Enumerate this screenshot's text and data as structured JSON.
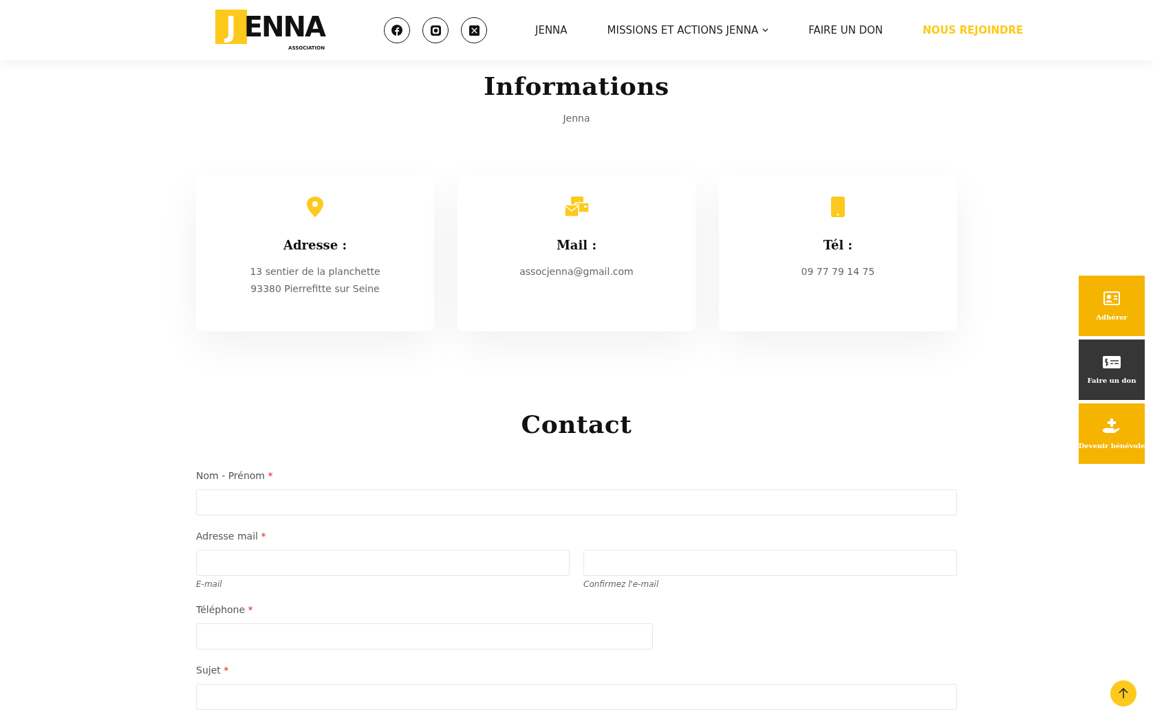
{
  "header": {
    "logo": {
      "letter": "J",
      "word": "ENNA",
      "tagline": "ASSOCIATION"
    },
    "social": [
      {
        "kind": "facebook"
      },
      {
        "kind": "instagram"
      },
      {
        "kind": "x"
      }
    ],
    "nav": [
      {
        "label": "JENNA",
        "selected": false,
        "dropdown": false
      },
      {
        "label": "MISSIONS ET ACTIONS JENNA",
        "selected": false,
        "dropdown": true
      },
      {
        "label": "FAIRE UN DON",
        "selected": false,
        "dropdown": false
      },
      {
        "label": "NOUS REJOINDRE",
        "selected": true,
        "dropdown": false
      }
    ]
  },
  "info": {
    "title": "Informations",
    "subtitle": "Jenna",
    "cards": [
      {
        "kind": "address",
        "title": "Adresse :",
        "lines": [
          "13 sentier de la planchette",
          "93380 Pierrefitte sur Seine"
        ]
      },
      {
        "kind": "mail",
        "title": "Mail :",
        "lines": [
          "assocjenna@gmail.com"
        ]
      },
      {
        "kind": "phone",
        "title": "Tél :",
        "lines": [
          "09 77 79 14 75"
        ]
      }
    ]
  },
  "contact": {
    "title": "Contact",
    "required_mark": "*",
    "fields": [
      {
        "kind": "full",
        "label": "Nom - Prénom",
        "required": true
      },
      {
        "kind": "double",
        "label": "Adresse mail",
        "required": true,
        "sublabels": [
          "E-mail",
          "Confirmez l'e-mail"
        ]
      },
      {
        "kind": "half",
        "label": "Téléphone",
        "required": true
      },
      {
        "kind": "full",
        "label": "Sujet",
        "required": true
      }
    ]
  },
  "side_buttons": [
    {
      "kind": "member",
      "label": "Adhérer",
      "color": "#f5b400"
    },
    {
      "kind": "donate",
      "label": "Faire un don",
      "color": "#363636"
    },
    {
      "kind": "volunteer",
      "label": "Devenir bénévole",
      "color": "#f5b400"
    }
  ]
}
